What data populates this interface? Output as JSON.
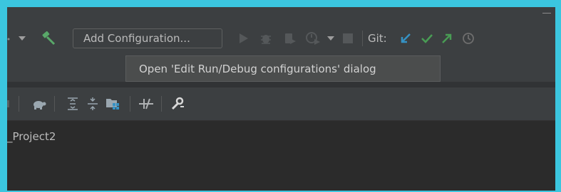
{
  "toolbar": {
    "add_configuration_label": "Add Configuration...",
    "git_label": "Git:",
    "icons": [
      "dropdown-arrow-icon",
      "build-hammer-icon",
      "run-icon",
      "debug-icon",
      "coverage-icon",
      "profile-icon",
      "more-dropdown-icon",
      "stop-icon",
      "git-update-icon",
      "git-commit-icon",
      "git-push-icon",
      "git-history-icon"
    ]
  },
  "tooltip": {
    "text": "Open 'Edit Run/Debug configurations' dialog"
  },
  "tool_window": {
    "icons": [
      "turtle-icon",
      "expand-all-icon",
      "collapse-all-icon",
      "module-icon",
      "toggle-offline-icon",
      "settings-wrench-icon"
    ]
  },
  "content": {
    "project_label": "_Project2"
  },
  "colors": {
    "frame_border": "#3bc6df",
    "toolbar_bg": "#3c3f41",
    "content_bg": "#2b2b2b",
    "git_blue": "#3592c4",
    "git_green": "#499c54",
    "hammer_green": "#59a869"
  }
}
